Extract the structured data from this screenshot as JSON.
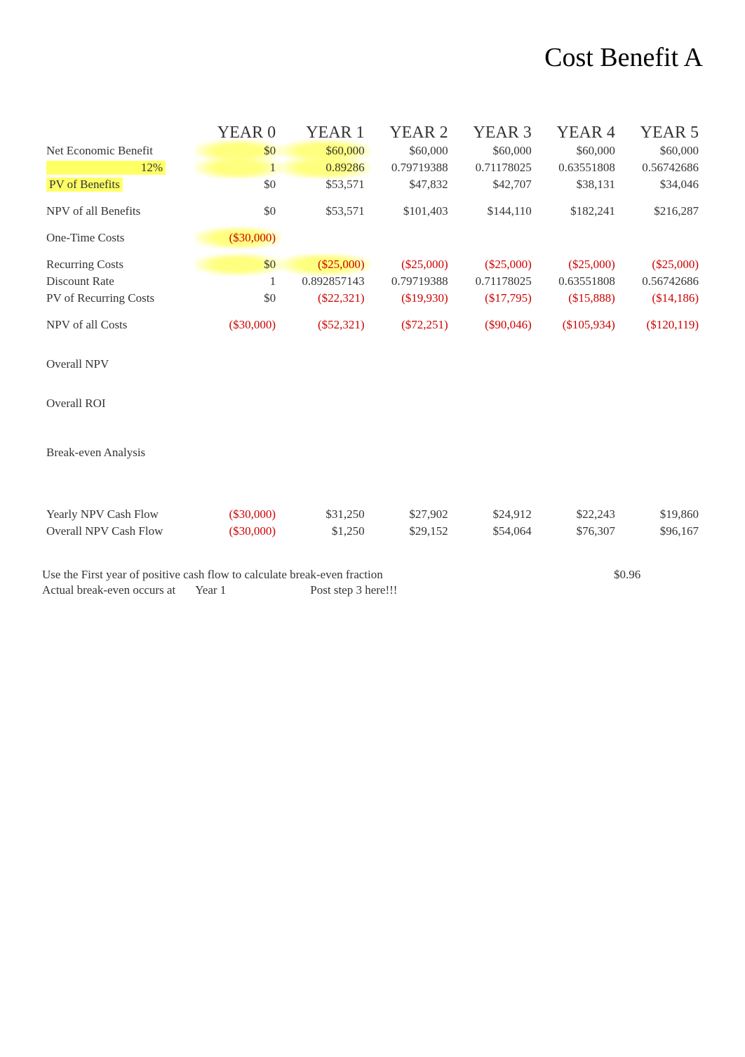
{
  "title": "Cost Benefit A",
  "headers": [
    "YEAR 0",
    "YEAR 1",
    "YEAR 2",
    "YEAR 3",
    "YEAR 4",
    "YEAR 5"
  ],
  "rows": {
    "net_economic_benefit": {
      "label": "Net Economic Benefit",
      "values": [
        "$0",
        "$60,000",
        "$60,000",
        "$60,000",
        "$60,000",
        "$60,000"
      ]
    },
    "discount_benefits": {
      "rate_label": "12%",
      "values": [
        "1",
        "0.89286",
        "0.79719388",
        "0.71178025",
        "0.63551808",
        "0.56742686"
      ]
    },
    "pv_benefits": {
      "label": "PV of Benefits",
      "values": [
        "$0",
        "$53,571",
        "$47,832",
        "$42,707",
        "$38,131",
        "$34,046"
      ]
    },
    "npv_benefits": {
      "label": "NPV of all Benefits",
      "values": [
        "$0",
        "$53,571",
        "$101,403",
        "$144,110",
        "$182,241",
        "$216,287"
      ]
    },
    "one_time_costs": {
      "label": "One-Time Costs",
      "values": [
        "($30,000)",
        "",
        "",
        "",
        "",
        ""
      ]
    },
    "recurring_costs": {
      "label": "Recurring Costs",
      "values": [
        "$0",
        "($25,000)",
        "($25,000)",
        "($25,000)",
        "($25,000)",
        "($25,000)"
      ]
    },
    "discount_rate": {
      "label": "Discount Rate",
      "values": [
        "1",
        "0.892857143",
        "0.79719388",
        "0.71178025",
        "0.63551808",
        "0.56742686"
      ]
    },
    "pv_recurring_costs": {
      "label": "PV of Recurring Costs",
      "values": [
        "$0",
        "($22,321)",
        "($19,930)",
        "($17,795)",
        "($15,888)",
        "($14,186)"
      ]
    },
    "npv_costs": {
      "label": "NPV of all Costs",
      "values": [
        "($30,000)",
        "($52,321)",
        "($72,251)",
        "($90,046)",
        "($105,934)",
        "($120,119)"
      ]
    },
    "overall_npv": {
      "label": "Overall NPV"
    },
    "overall_roi": {
      "label": "Overall ROI"
    },
    "break_even": {
      "label": "Break-even Analysis"
    },
    "yearly_npv_cf": {
      "label": "Yearly NPV Cash Flow",
      "values": [
        "($30,000)",
        "$31,250",
        "$27,902",
        "$24,912",
        "$22,243",
        "$19,860"
      ]
    },
    "overall_npv_cf": {
      "label": "Overall NPV Cash Flow",
      "values": [
        "($30,000)",
        "$1,250",
        "$29,152",
        "$54,064",
        "$76,307",
        "$96,167"
      ]
    }
  },
  "footnote": {
    "line1_label": "Use the First year of positive cash flow to calculate break-even fraction",
    "line1_value": "$0.96",
    "line2_label": "Actual break-even occurs at",
    "line2_value": "Year 1",
    "line2_note": "Post step 3 here!!!"
  }
}
